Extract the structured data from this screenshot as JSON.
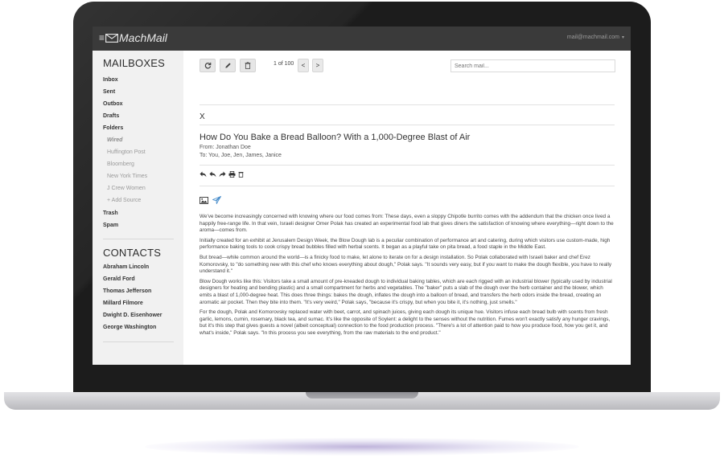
{
  "app": {
    "brand_menu_glyph": "≡",
    "brand_name": "MachMail",
    "account_email": "mail@machmail.com",
    "account_caret": "▾"
  },
  "sidebar": {
    "mailboxes_heading": "MAILBOXES",
    "items": [
      {
        "label": "Inbox"
      },
      {
        "label": "Sent"
      },
      {
        "label": "Outbox"
      },
      {
        "label": "Drafts"
      },
      {
        "label": "Folders"
      }
    ],
    "folders": [
      {
        "label": "Wired",
        "active": true
      },
      {
        "label": "Huffington Post"
      },
      {
        "label": "Bloomberg"
      },
      {
        "label": "New York Times"
      },
      {
        "label": "J Crew Women"
      },
      {
        "label": "+ Add Source"
      }
    ],
    "trash": "Trash",
    "spam": "Spam",
    "contacts_heading": "CONTACTS",
    "contacts": [
      {
        "label": "Abraham Lincoln"
      },
      {
        "label": "Gerald Ford"
      },
      {
        "label": "Thomas Jefferson"
      },
      {
        "label": "Millard Filmore"
      },
      {
        "label": "Dwight D. Eisenhower"
      },
      {
        "label": "George Washington"
      }
    ]
  },
  "toolbar": {
    "icons": [
      "refresh-icon",
      "pencil-icon",
      "trash-icon"
    ],
    "pager_text": "1 of 100",
    "prev": "<",
    "next": ">",
    "search_placeholder": "Search mail..."
  },
  "message": {
    "close": "X",
    "subject": "How Do You Bake a Bread Balloon? With a 1,000-Degree Blast of Air",
    "from": "From: Jonathan Doe",
    "to": "To: You, Joe, Jen, James, Janice",
    "action_icons": [
      "reply-icon",
      "reply-all-icon",
      "forward-icon",
      "print-icon",
      "trash-icon"
    ],
    "attachment_icons": [
      "image-icon",
      "send-icon"
    ],
    "accent_color": "#4a8ecb",
    "paragraphs": [
      "We've become increasingly concerned with knowing where our food comes from: These days, even a sloppy Chipotle burrito comes with the addendum that the chicken once lived a happily free-range life. In that vein, Israeli designer Omer Polak has created an experimental food lab that gives diners the satisfaction of knowing where everything—right down to the aroma—comes from.",
      "Initially created for an exhibit at Jerusalem Design Week, the Blow Dough lab is a peculiar combination of performance art and catering, during which visitors use custom-made, high performance baking tools to cook crispy bread bubbles filled with herbal scents. It began as a playful take on pita bread, a food staple in the Middle East.",
      "But bread—while common around the world—is a finicky food to make, let alone to iterate on for a design installation. So Polak collaborated with Israeli baker and chef Erez Komorovsky, to \"do something new with this chef who knows everything about dough,\" Polak says. \"It sounds very easy, but if you want to make the dough flexible, you have to really understand it.\"",
      "Blow Dough works like this: Visitors take a small amount of pre-kneaded dough to individual baking tables, which are each rigged with an industrial blower (typically used by industrial designers for heating and bending plastic) and a small compartment for herbs and vegetables. The \"baker\" puts a slab of the dough over the herb container and the blower, which emits a blast of 1,000-degree heat. This does three things: bakes the dough, inflates the dough into a balloon of bread, and transfers the herb odors inside the bread, creating an aromatic air pocket. Then they bite into them. \"It's very weird,\" Polak says, \"because it's crispy, but when you bite it, it's nothing, just smells.\"",
      "For the dough, Polak and Komorovsky replaced water with beet, carrot, and spinach juices, giving each dough its unique hue. Visitors infuse each bread bulb with scents from fresh garlic, lemons, cumin, rosemary, black tea, and sumac. It's like the opposite of Soylent: a delight to the senses without the nutrition. Fumes won't exactly satisfy any hunger cravings, but it's this step that gives guests a novel (albeit conceptual) connection to the food production process. \"There's a lot of attention paid to how you produce food, how you get it, and what's inside,\" Polak says. \"In this process you see everything, from the raw materials to the end product.\""
    ]
  }
}
